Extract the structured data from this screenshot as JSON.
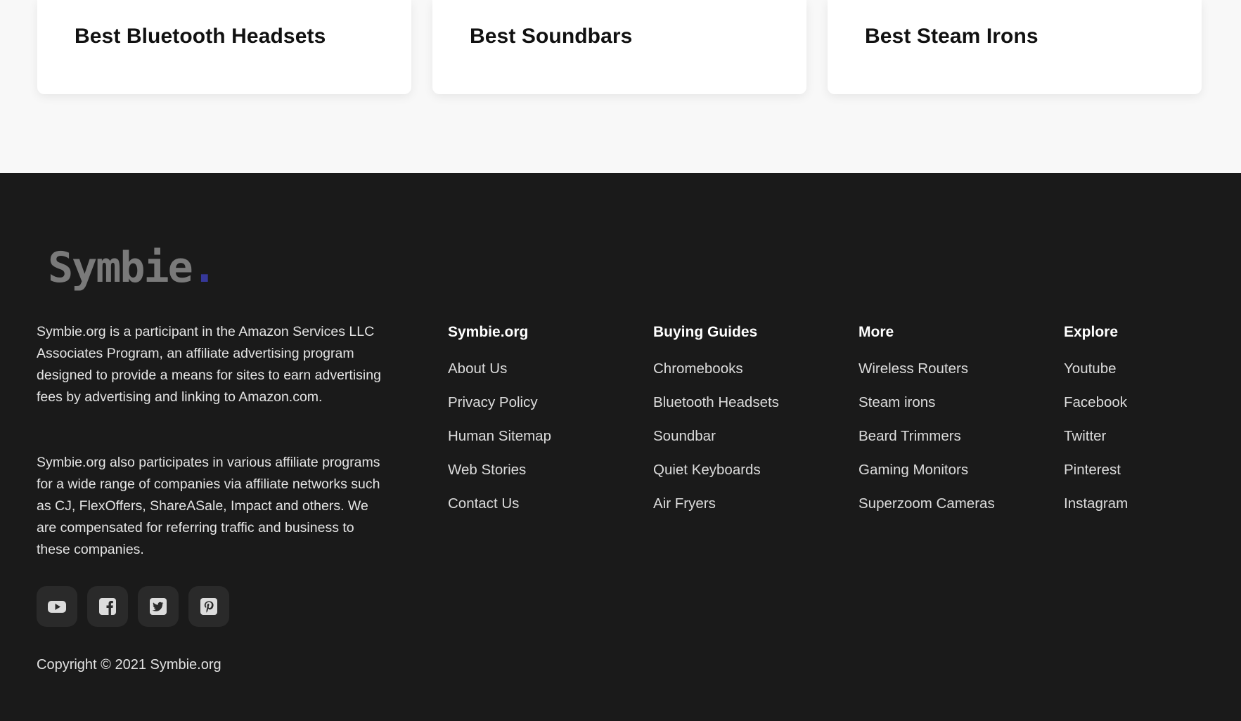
{
  "cards": [
    {
      "title": "Best Bluetooth Headsets"
    },
    {
      "title": "Best Soundbars"
    },
    {
      "title": "Best Steam Irons"
    }
  ],
  "footer": {
    "logo": {
      "text": "Symbie",
      "dot": ".",
      "dot_color": "#36389a"
    },
    "disclaimer": [
      "Symbie.org is a participant in the Amazon Services LLC Associates Program, an affiliate advertising program designed to provide a means for sites to earn advertising fees by advertising and linking to Amazon.com.",
      "Symbie.org also participates in various affiliate programs for a wide range of companies via affiliate networks such as CJ, FlexOffers, ShareASale, Impact and others. We are compensated for referring traffic and business to these companies."
    ],
    "columns": [
      {
        "heading": "Symbie.org",
        "links": [
          "About Us",
          "Privacy Policy",
          "Human Sitemap",
          "Web Stories",
          "Contact Us"
        ]
      },
      {
        "heading": "Buying Guides",
        "links": [
          "Chromebooks",
          "Bluetooth Headsets",
          "Soundbar",
          "Quiet Keyboards",
          "Air Fryers"
        ]
      },
      {
        "heading": "More",
        "links": [
          "Wireless Routers",
          "Steam irons",
          "Beard Trimmers",
          "Gaming Monitors",
          "Superzoom Cameras"
        ]
      },
      {
        "heading": "Explore",
        "links": [
          "Youtube",
          "Facebook",
          "Twitter",
          "Pinterest",
          "Instagram"
        ]
      }
    ],
    "social_icons": [
      "youtube-icon",
      "facebook-icon",
      "twitter-icon",
      "pinterest-icon"
    ],
    "copyright": "Copyright © 2021 Symbie.org"
  },
  "colors": {
    "footer_bg": "#1a1a1a",
    "page_bg": "#f8f8f8",
    "card_bg": "#ffffff",
    "social_bg": "#2a2a2a",
    "icon_color": "#dcdcdc"
  }
}
